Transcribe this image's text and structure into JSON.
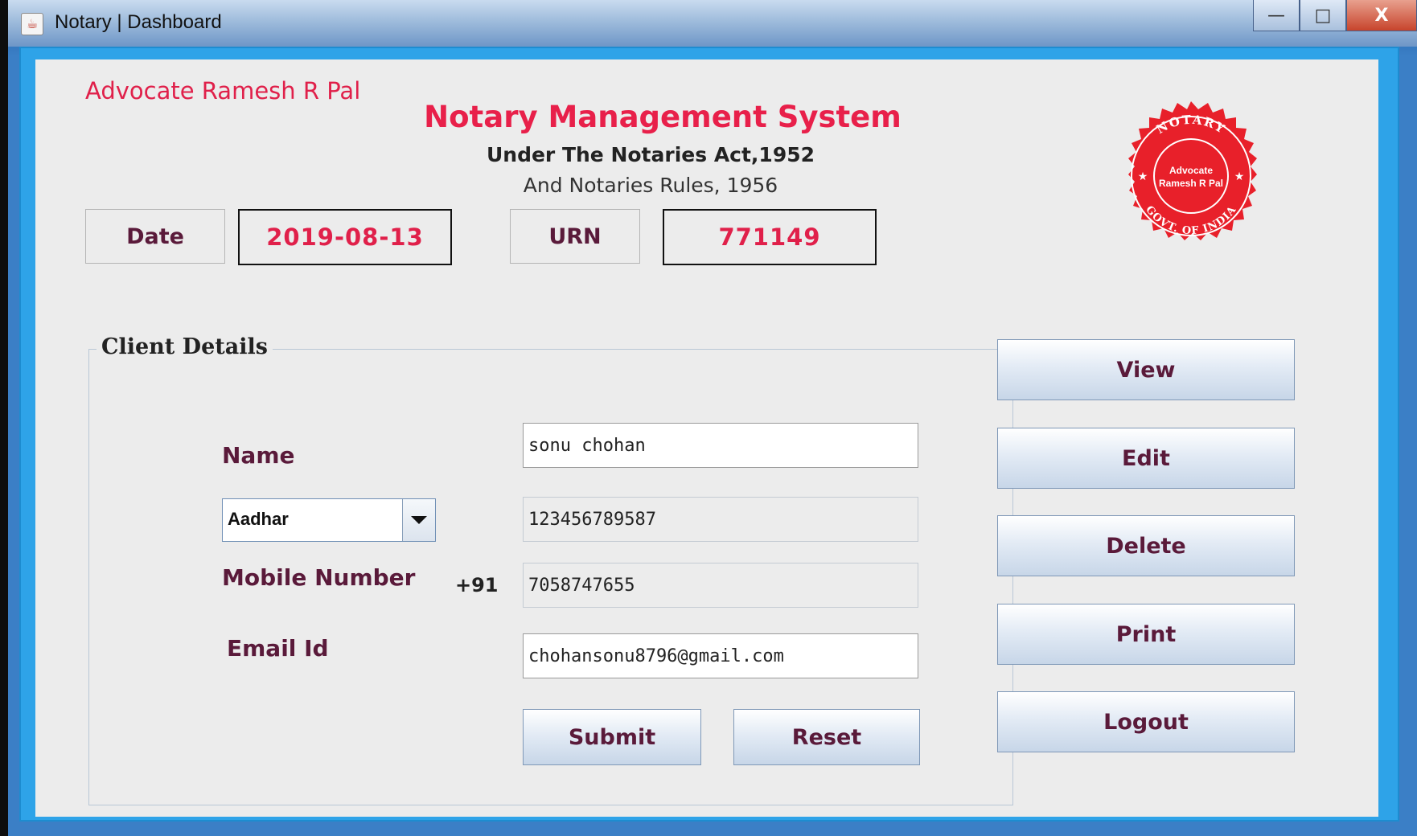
{
  "window": {
    "title": "Notary | Dashboard",
    "controls": {
      "minimize": "—",
      "maximize": "□",
      "close": "X"
    }
  },
  "header": {
    "advocate_name": "Advocate Ramesh R Pal",
    "app_title": "Notary Management System",
    "subtitle_line1": "Under The Notaries Act,1952",
    "subtitle_line2": "And Notaries Rules, 1956"
  },
  "stamp": {
    "top_text": "NOTARY",
    "center_line1": "Advocate",
    "center_line2": "Ramesh R Pal",
    "bottom_text": "GOVT. OF INDIA",
    "color": "#e8202a"
  },
  "info": {
    "date_label": "Date",
    "date_value": "2019-08-13",
    "urn_label": "URN",
    "urn_value": "771149"
  },
  "client_details": {
    "legend": "Client Details",
    "name_label": "Name",
    "name_value": "sonu chohan",
    "id_type_selected": "Aadhar",
    "id_number_value": "123456789587",
    "mobile_label": "Mobile Number",
    "mobile_prefix": "+91",
    "mobile_value": "7058747655",
    "email_label": "Email Id",
    "email_value": "chohansonu8796@gmail.com",
    "submit_label": "Submit",
    "reset_label": "Reset"
  },
  "side_buttons": {
    "view": "View",
    "edit": "Edit",
    "delete": "Delete",
    "print": "Print",
    "logout": "Logout"
  },
  "colors": {
    "accent_red": "#e0204a",
    "label_maroon": "#5a1a3a",
    "frame_blue": "#2ea3e8"
  }
}
